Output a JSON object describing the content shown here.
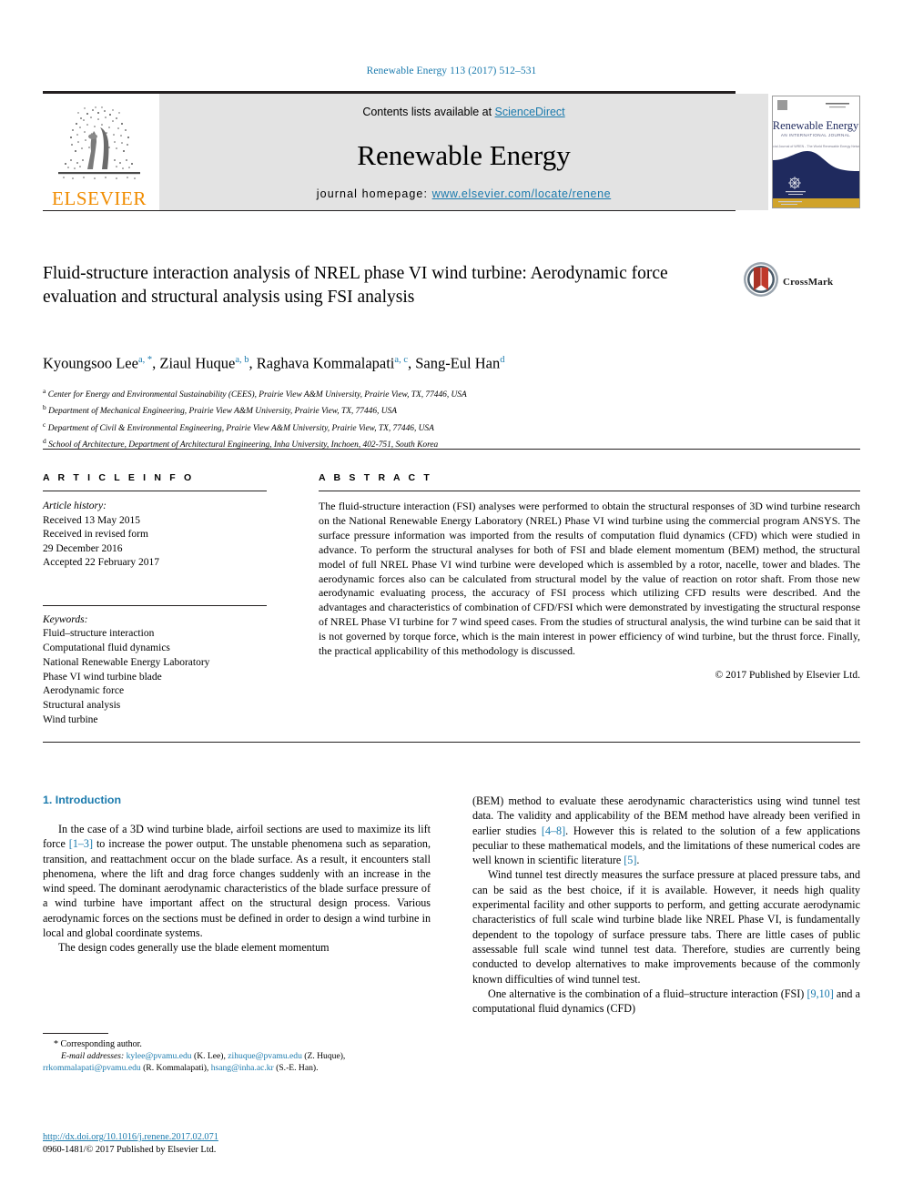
{
  "running_head": "Renewable Energy 113 (2017) 512–531",
  "masthead": {
    "contents_prefix": "Contents lists available at ",
    "sciencedirect": "ScienceDirect",
    "journal_name": "Renewable Energy",
    "homepage_prefix": "journal homepage: ",
    "homepage_url": "www.elsevier.com/locate/renene",
    "publisher_logo_text": "ELSEVIER",
    "publisher_logo_icon": "elsevier-tree-icon",
    "cover_title": "Renewable Energy",
    "cover_subtitle": "AN INTERNATIONAL JOURNAL",
    "cover_tagline": "Official Journal of WREN - The World Renewable Energy Network"
  },
  "colors": {
    "link_blue": "#1a7aad",
    "elsevier_orange": "#f08c00",
    "banner_grey": "#e3e3e3",
    "cover_navy": "#1f2a5e",
    "cover_gold": "#d0a32a",
    "crossmark_red": "#c0392b",
    "rule_black": "#231f20"
  },
  "crossmark": {
    "label": "CrossMark",
    "icon": "crossmark-icon"
  },
  "article": {
    "title": "Fluid-structure interaction analysis of NREL phase VI wind turbine: Aerodynamic force evaluation and structural analysis using FSI analysis",
    "authors": [
      {
        "name": "Kyoungsoo Lee",
        "marks": "a, *"
      },
      {
        "name": "Ziaul Huque",
        "marks": "a, b"
      },
      {
        "name": "Raghava Kommalapati",
        "marks": "a, c"
      },
      {
        "name": "Sang-Eul Han",
        "marks": "d"
      }
    ],
    "affiliations": [
      {
        "mark": "a",
        "text": "Center for Energy and Environmental Sustainability (CEES), Prairie View A&M University, Prairie View, TX, 77446, USA"
      },
      {
        "mark": "b",
        "text": "Department of Mechanical Engineering, Prairie View A&M University, Prairie View, TX, 77446, USA"
      },
      {
        "mark": "c",
        "text": "Department of Civil & Environmental Engineering, Prairie View A&M University, Prairie View, TX, 77446, USA"
      },
      {
        "mark": "d",
        "text": "School of Architecture, Department of Architectural Engineering, Inha University, Inchoen, 402-751, South Korea"
      }
    ]
  },
  "article_info": {
    "heading": "A R T I C L E    I N F O",
    "history_label": "Article history:",
    "history_lines": [
      "Received 13 May 2015",
      "Received in revised form",
      "29 December 2016",
      "Accepted 22 February 2017"
    ],
    "keywords_label": "Keywords:",
    "keywords": [
      "Fluid–structure interaction",
      "Computational fluid dynamics",
      "National Renewable Energy Laboratory",
      "Phase VI wind turbine blade",
      "Aerodynamic force",
      "Structural analysis",
      "Wind turbine"
    ]
  },
  "abstract": {
    "heading": "A B S T R A C T",
    "text": "The fluid-structure interaction (FSI) analyses were performed to obtain the structural responses of 3D wind turbine research on the National Renewable Energy Laboratory (NREL) Phase VI wind turbine using the commercial program ANSYS. The surface pressure information was imported from the results of computation fluid dynamics (CFD) which were studied in advance. To perform the structural analyses for both of FSI and blade element momentum (BEM) method, the structural model of full NREL Phase VI wind turbine were developed which is assembled by a rotor, nacelle, tower and blades. The aerodynamic forces also can be calculated from structural model by the value of reaction on rotor shaft. From those new aerodynamic evaluating process, the accuracy of FSI process which utilizing CFD results were described. And the advantages and characteristics of combination of CFD/FSI which were demonstrated by investigating the structural response of NREL Phase VI turbine for 7 wind speed cases. From the studies of structural analysis, the wind turbine can be said that it is not governed by torque force, which is the main interest in power efficiency of wind turbine, but the thrust force. Finally, the practical applicability of this methodology is discussed.",
    "copyright": "© 2017 Published by Elsevier Ltd."
  },
  "body": {
    "section_number": "1.",
    "section_title": "Introduction",
    "left_paragraphs": [
      "In the case of a 3D wind turbine blade, airfoil sections are used to maximize its lift force [1–3] to increase the power output. The unstable phenomena such as separation, transition, and reattachment occur on the blade surface. As a result, it encounters stall phenomena, where the lift and drag force changes suddenly with an increase in the wind speed. The dominant aerodynamic characteristics of the blade surface pressure of a wind turbine have important affect on the structural design process. Various aerodynamic forces on the sections must be defined in order to design a wind turbine in local and global coordinate systems.",
      "The design codes generally use the blade element momentum"
    ],
    "right_paragraphs": [
      "(BEM) method to evaluate these aerodynamic characteristics using wind tunnel test data. The validity and applicability of the BEM method have already been verified in earlier studies [4–8]. However this is related to the solution of a few applications peculiar to these mathematical models, and the limitations of these numerical codes are well known in scientific literature [5].",
      "Wind tunnel test directly measures the surface pressure at placed pressure tabs, and can be said as the best choice, if it is available. However, it needs high quality experimental facility and other supports to perform, and getting accurate aerodynamic characteristics of full scale wind turbine blade like NREL Phase VI, is fundamentally dependent to the topology of surface pressure tabs. There are little cases of public assessable full scale wind tunnel test data. Therefore, studies are currently being conducted to develop alternatives to make improvements because of the commonly known difficulties of wind tunnel test.",
      "One alternative is the combination of a fluid–structure interaction (FSI) [9,10] and a computational fluid dynamics (CFD)"
    ]
  },
  "footnote": {
    "corresponding": "* Corresponding author.",
    "email_label": "E-mail addresses:",
    "emails": [
      {
        "address": "kylee@pvamu.edu",
        "who": "(K. Lee)"
      },
      {
        "address": "zihuque@pvamu.edu",
        "who": "(Z. Huque)"
      },
      {
        "address": "rrkommalapati@pvamu.edu",
        "who": "(R. Kommalapati)"
      },
      {
        "address": "hsang@inha.ac.kr",
        "who": "(S.-E. Han)"
      }
    ]
  },
  "imprint": {
    "doi": "http://dx.doi.org/10.1016/j.renene.2017.02.071",
    "issn_line": "0960-1481/© 2017 Published by Elsevier Ltd."
  }
}
